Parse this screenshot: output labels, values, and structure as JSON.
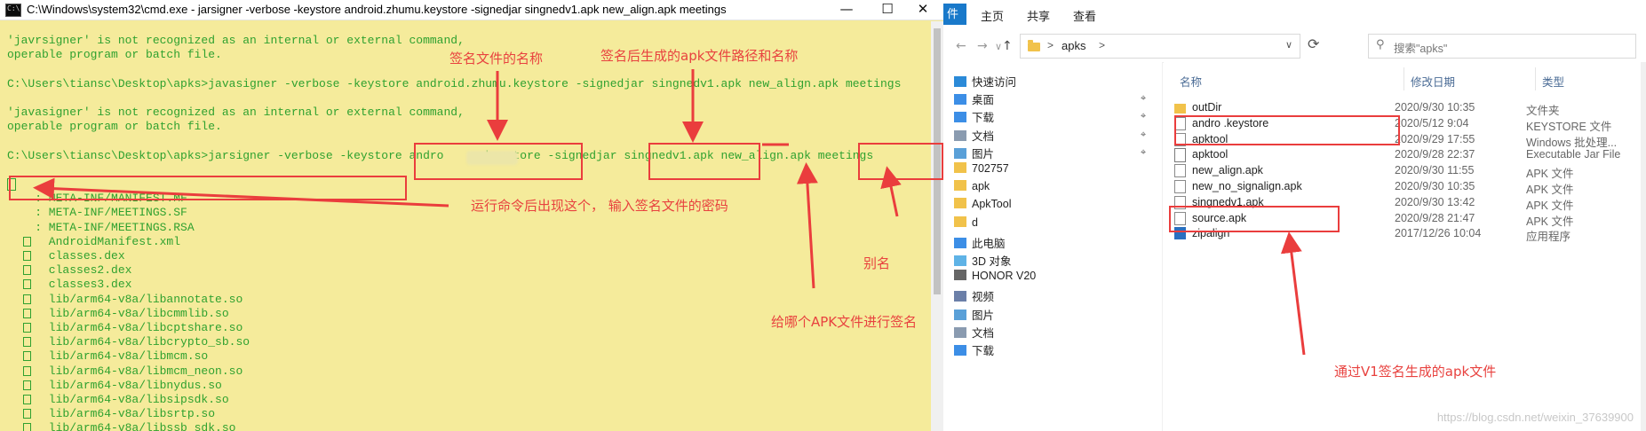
{
  "cmd": {
    "title": "C:\\Windows\\system32\\cmd.exe - jarsigner  -verbose -keystore android.zhumu.keystore -signedjar singnedv1.apk new_align.apk meetings",
    "controls": {
      "minimize": "—",
      "maximize": "☐",
      "close": "✕"
    },
    "lines": [
      "'javrsigner' is not recognized as an internal or external command,",
      "operable program or batch file.",
      "",
      "C:\\Users\\tiansc\\Desktop\\apks>javasigner -verbose -keystore android.zhumu.keystore -signedjar singnedv1.apk new_align.apk meetings",
      "",
      "'javasigner' is not recognized as an internal or external command,",
      "operable program or batch file.",
      "",
      "C:\\Users\\tiansc\\Desktop\\apks>jarsigner -verbose -keystore andro     .keystore -signedjar singnedv1.apk new_align.apk meetings",
      "",
      "",
      "    : META-INF/MANIFEST.MF",
      "    : META-INF/MEETINGS.SF",
      "    : META-INF/MEETINGS.RSA",
      "      AndroidManifest.xml",
      "      classes.dex",
      "      classes2.dex",
      "      classes3.dex",
      "      lib/arm64-v8a/libannotate.so",
      "      lib/arm64-v8a/libcmmlib.so",
      "      lib/arm64-v8a/libcptshare.so",
      "      lib/arm64-v8a/libcrypto_sb.so",
      "      lib/arm64-v8a/libmcm.so",
      "      lib/arm64-v8a/libmcm_neon.so",
      "      lib/arm64-v8a/libnydus.so",
      "      lib/arm64-v8a/libsipsdk.so",
      "      lib/arm64-v8a/libsrtp.so",
      "      lib/arm64-v8a/libssb_sdk.so"
    ]
  },
  "annotations": {
    "keystore_name": "签名文件的名称",
    "output_apk": "签名后生成的apk文件路径和名称",
    "password_hint": "运行命令后出现这个， 输入签名文件的密码",
    "alias": "别名",
    "target_apk": "给哪个APK文件进行签名",
    "v1_result": "通过V1签名生成的apk文件"
  },
  "explorer": {
    "ribbon_tabs": [
      "件",
      "主页",
      "共享",
      "查看"
    ],
    "nav": {
      "back": "←",
      "forward": "→",
      "dropdown": "∨",
      "up": "↑",
      "refresh": "⟳"
    },
    "address": {
      "path": "apks",
      "sep": ">"
    },
    "search_placeholder": "搜索\"apks\"",
    "columns": {
      "name": "名称",
      "date": "修改日期",
      "type": "类型"
    },
    "nav_items": [
      {
        "label": "快速访问",
        "icon": "star-icon",
        "pinned": false
      },
      {
        "label": "桌面",
        "icon": "desktop-icon",
        "pinned": true
      },
      {
        "label": "下载",
        "icon": "download-icon",
        "pinned": true
      },
      {
        "label": "文档",
        "icon": "document-icon",
        "pinned": true
      },
      {
        "label": "图片",
        "icon": "picture-icon",
        "pinned": true
      },
      {
        "label": "702757",
        "icon": "folder-icon",
        "pinned": false
      },
      {
        "label": "apk",
        "icon": "folder-icon",
        "pinned": false
      },
      {
        "label": "ApkTool",
        "icon": "folder-icon",
        "pinned": false
      },
      {
        "label": "d",
        "icon": "folder-icon",
        "pinned": false
      },
      {
        "label": "此电脑",
        "icon": "computer-icon",
        "pinned": false
      },
      {
        "label": "3D 对象",
        "icon": "cube-icon",
        "pinned": false
      },
      {
        "label": "HONOR V20",
        "icon": "phone-icon",
        "pinned": false
      },
      {
        "label": "视频",
        "icon": "video-icon",
        "pinned": false
      },
      {
        "label": "图片",
        "icon": "picture-icon",
        "pinned": false
      },
      {
        "label": "文档",
        "icon": "document-icon",
        "pinned": false
      },
      {
        "label": "下载",
        "icon": "download-icon",
        "pinned": false
      }
    ],
    "files": [
      {
        "name": "outDir",
        "date": "2020/9/30 10:35",
        "type": "文件夹",
        "icon": "folder-icon"
      },
      {
        "name": "andro           .keystore",
        "date": "2020/5/12 9:04",
        "type": "KEYSTORE 文件",
        "icon": "file-icon"
      },
      {
        "name": "apktool",
        "date": "2020/9/29 17:55",
        "type": "Windows 批处理...",
        "icon": "batch-icon"
      },
      {
        "name": "apktool",
        "date": "2020/9/28 22:37",
        "type": "Executable Jar File",
        "icon": "jar-icon"
      },
      {
        "name": "new_align.apk",
        "date": "2020/9/30 11:55",
        "type": "APK 文件",
        "icon": "file-icon"
      },
      {
        "name": "new_no_signalign.apk",
        "date": "2020/9/30 10:35",
        "type": "APK 文件",
        "icon": "file-icon"
      },
      {
        "name": "singnedv1.apk",
        "date": "2020/9/30 13:42",
        "type": "APK 文件",
        "icon": "file-icon"
      },
      {
        "name": "source.apk",
        "date": "2020/9/28 21:47",
        "type": "APK 文件",
        "icon": "file-icon"
      },
      {
        "name": "zipalign",
        "date": "2017/12/26 10:04",
        "type": "应用程序",
        "icon": "app-icon"
      }
    ],
    "watermark": "https://blog.csdn.net/weixin_37639900"
  },
  "colors": {
    "cmd_bg": "#f5eb9b",
    "cmd_text": "#2fa12f",
    "annotation": "#e8423f",
    "explorer_accent": "#1979ca"
  }
}
